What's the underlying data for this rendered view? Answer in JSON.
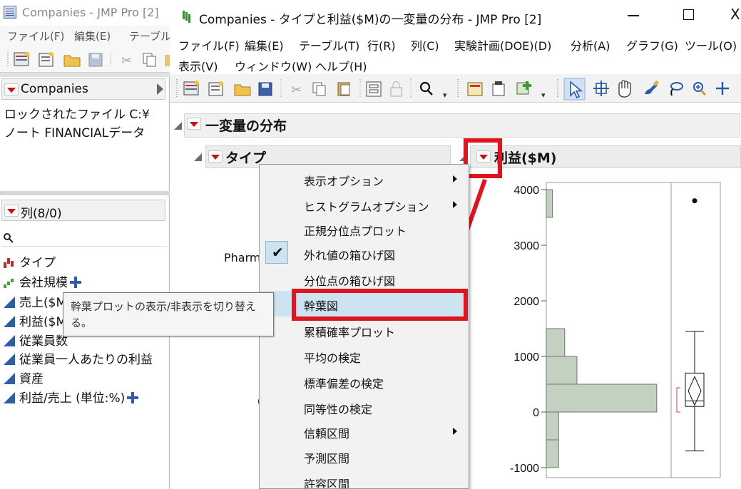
{
  "back_window": {
    "title": "Companies - JMP Pro [2]",
    "menu": [
      "ファイル(F)",
      "編集(E)",
      "テーブル"
    ],
    "table_panel": {
      "title": "Companies",
      "line1": "ロックされたファイル C:¥",
      "line2": "ノート FINANCIALデータ"
    },
    "columns_panel": {
      "title": "列(8/0)",
      "search_icon": "search-icon",
      "columns": [
        {
          "name": "タイプ",
          "icon": "nominal-bar-icon"
        },
        {
          "name": "会社規模",
          "icon": "ordinal-bar-icon"
        },
        {
          "name": "売上($M)",
          "icon": "continuous-icon"
        },
        {
          "name": "利益($M)",
          "icon": "continuous-icon"
        },
        {
          "name": "従業員数",
          "icon": "continuous-icon"
        },
        {
          "name": "従業員一人あたりの利益",
          "icon": "continuous-icon"
        },
        {
          "name": "資産",
          "icon": "continuous-icon"
        },
        {
          "name": "利益/売上 (単位:%)",
          "icon": "continuous-icon"
        }
      ],
      "col2_partial": "売上($M",
      "col3_partial": "利益($M",
      "col4_partial": "従業員数"
    }
  },
  "main_window": {
    "title": "Companies - タイプと利益($M)の一変量の分布 - JMP Pro [2]",
    "close_glyph": "X",
    "menu_row1": [
      "ファイル(F)",
      "編集(E)",
      "テーブル(T)",
      "行(R)",
      "列(C)",
      "実験計画(DOE)(D)",
      "分析(A)",
      "グラフ(G)",
      "ツール(O)"
    ],
    "menu_row2": [
      "表示(V)",
      "ウィンドウ(W)",
      "ヘルプ(H)"
    ]
  },
  "report": {
    "section_title": "一変量の分布",
    "type_title": "タイプ",
    "profit_title": "利益($M)",
    "pharm_label": "Pharm",
    "type_cut_label": "C"
  },
  "context_menu": {
    "items": [
      {
        "label": "表示オプション",
        "submenu": true
      },
      {
        "label": "ヒストグラムオプション",
        "submenu": true
      },
      {
        "label": "正規分位点プロット",
        "submenu": false
      },
      {
        "label": "外れ値の箱ひげ図",
        "submenu": false,
        "checked": true
      },
      {
        "label": "分位点の箱ひげ図",
        "submenu": false
      },
      {
        "label": "幹葉図",
        "submenu": false,
        "highlighted": true
      },
      {
        "label": "累積確率プロット",
        "submenu": false
      },
      {
        "label": "平均の検定",
        "submenu": false
      },
      {
        "label": "標準偏差の検定",
        "submenu": false
      },
      {
        "label": "同等性の検定",
        "submenu": false
      },
      {
        "label": "信頼区間",
        "submenu": true
      },
      {
        "label": "予測区間",
        "submenu": false
      },
      {
        "label": "許容区間",
        "submenu": false
      }
    ],
    "check_glyph": "✔"
  },
  "tooltip": {
    "text": "幹葉プロットの表示/非表示を切り替える。"
  },
  "colors": {
    "highlight_red": "#e0141e",
    "histogram_fill": "#c3d1c1",
    "menu_highlight": "#cde3ef"
  },
  "chart_data": {
    "type": "bar",
    "orientation": "horizontal histogram",
    "ylim": [
      -1000,
      4500
    ],
    "yticks": [
      4000,
      3000,
      2000,
      1000,
      0,
      -1000
    ],
    "bins": [
      {
        "from": -1000,
        "to": -500,
        "count": 2
      },
      {
        "from": -500,
        "to": 0,
        "count": 2
      },
      {
        "from": 0,
        "to": 500,
        "count": 18
      },
      {
        "from": 500,
        "to": 1000,
        "count": 5
      },
      {
        "from": 1000,
        "to": 1500,
        "count": 3
      },
      {
        "from": 3500,
        "to": 4000,
        "count": 1
      }
    ],
    "boxplot": {
      "whisker_low": -700,
      "q1": 100,
      "median": 200,
      "q3": 700,
      "whisker_high": 1450,
      "mean": 380,
      "outliers": [
        3800
      ]
    }
  }
}
